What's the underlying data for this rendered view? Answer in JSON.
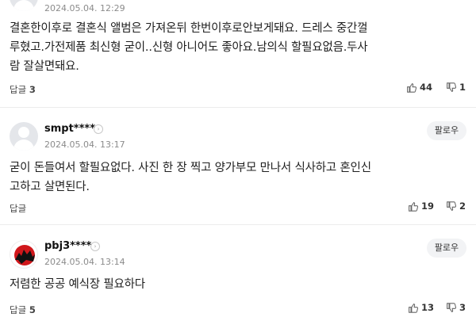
{
  "comments": [
    {
      "username": "",
      "timestamp": "2024.05.04. 12:29",
      "lines": [
        "결혼한이후로 결혼식 앨범은 가져온뒤 한번이후로안보게돼요. 드레스 중간껄",
        "루혔고.가전제품 최신형 굳이..신형 아니어도 좋아요.남의식 할필요없음.두사",
        "람 잘살면돼요."
      ],
      "reply_label": "답글",
      "reply_count": "3",
      "likes": "44",
      "dislikes": "1"
    },
    {
      "username": "smpt****",
      "timestamp": "2024.05.04. 13:17",
      "follow_label": "팔로우",
      "lines": [
        "굳이 돈들여서 할필요없다. 사진 한 장 찍고 양가부모 만나서 식사하고 혼인신",
        "고하고 살면된다."
      ],
      "reply_label": "답글",
      "reply_count": "",
      "likes": "19",
      "dislikes": "2"
    },
    {
      "username": "pbj3****",
      "timestamp": "2024.05.04. 13:14",
      "follow_label": "팔로우",
      "lines": [
        "저렴한 공공 예식장 필요하다"
      ],
      "reply_label": "답글",
      "reply_count": "5",
      "likes": "13",
      "dislikes": "3"
    }
  ],
  "colors": {
    "text": "#1f1f1f",
    "meta": "#8b8b8b",
    "divider": "#ececec",
    "follow_bg": "#f2f3f5"
  },
  "icons": {
    "avatar_default": "default-user-avatar",
    "avatar_custom": "red-circle-avatar",
    "like": "thumbs-up-icon",
    "dislike": "thumbs-down-icon",
    "user_menu": "chevron-right-icon"
  }
}
